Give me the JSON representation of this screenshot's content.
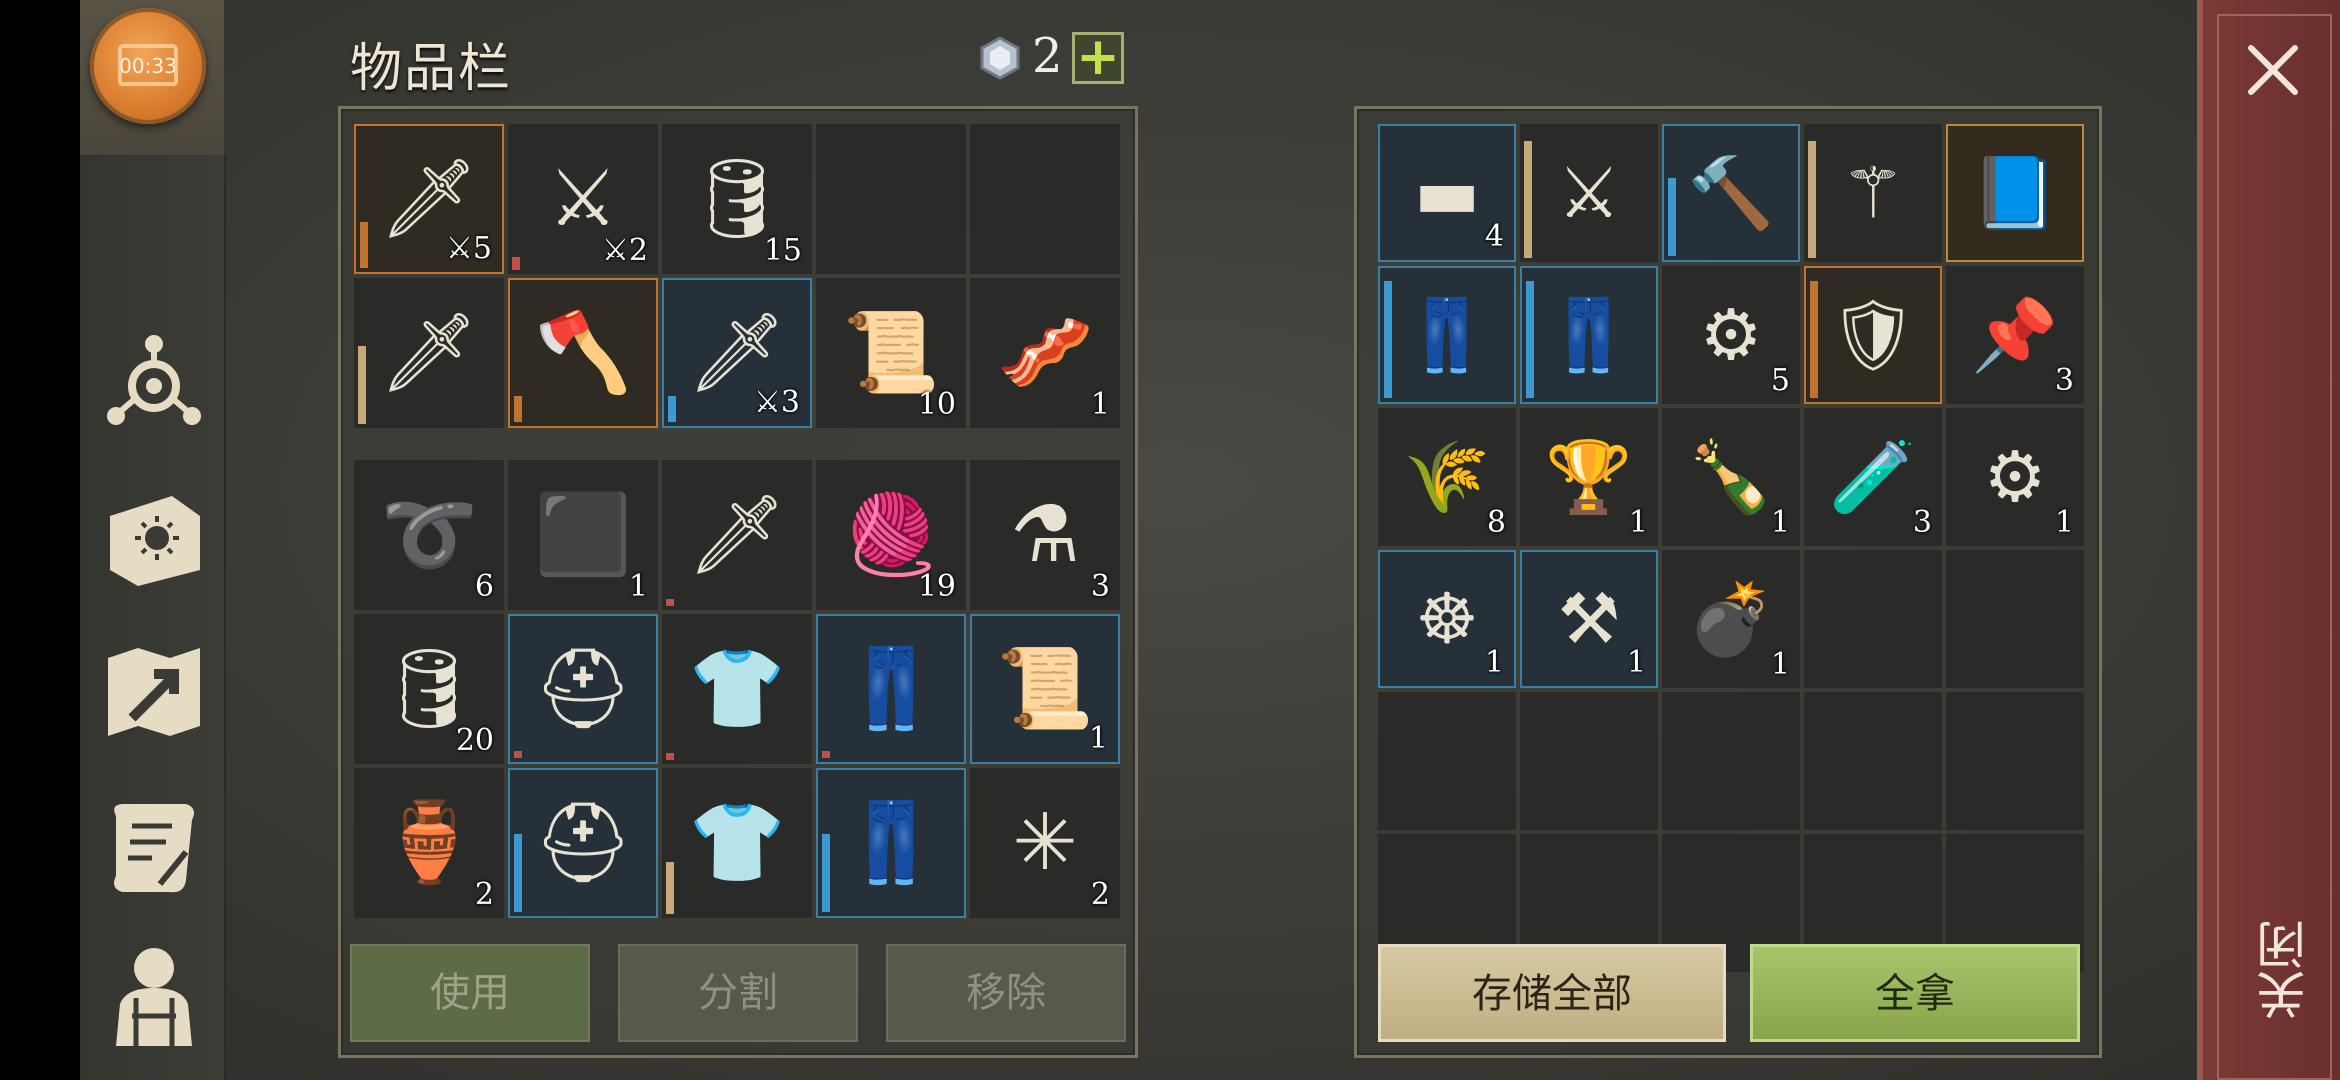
{
  "sidebar": {
    "chest_timer": "00:33",
    "icons": [
      "skills-icon",
      "sun-book-icon",
      "map-icon",
      "quest-scroll-icon",
      "character-icon"
    ]
  },
  "inventory": {
    "title": "物品栏",
    "currency_count": "2",
    "add_label": "+",
    "top_slots": [
      {
        "icon": "scimitar-icon",
        "glyph": "🗡",
        "count": "⚔5",
        "sel": "orange",
        "bar": "#c0742e",
        "barh": 0.35
      },
      {
        "icon": "sword-icon",
        "glyph": "⚔",
        "count": "⚔2",
        "sel": "",
        "bar": "#c0504a",
        "barh": 0.1
      },
      {
        "icon": "barrel-icon",
        "glyph": "🛢",
        "count": "15",
        "sel": "",
        "bar": "",
        "barh": 0
      },
      {
        "icon": "",
        "glyph": "",
        "count": "",
        "sel": "",
        "bar": "",
        "barh": 0
      },
      {
        "icon": "",
        "glyph": "",
        "count": "",
        "sel": "",
        "bar": "",
        "barh": 0
      },
      {
        "icon": "bronze-sword-icon",
        "glyph": "🗡",
        "count": "",
        "sel": "",
        "bar": "#c7a878",
        "barh": 0.6
      },
      {
        "icon": "battle-axe-icon",
        "glyph": "🪓",
        "count": "",
        "sel": "orange",
        "bar": "#c0742e",
        "barh": 0.2
      },
      {
        "icon": "scimitar-icon",
        "glyph": "🗡",
        "count": "⚔3",
        "sel": "blue",
        "bar": "#3c9ad0",
        "barh": 0.2
      },
      {
        "icon": "cloth-roll-icon",
        "glyph": "📜",
        "count": "10",
        "sel": "",
        "bar": "",
        "barh": 0
      },
      {
        "icon": "leather-icon",
        "glyph": "🥓",
        "count": "1",
        "sel": "",
        "bar": "",
        "barh": 0
      }
    ],
    "bottom_slots": [
      {
        "icon": "rope-icon",
        "glyph": "➰",
        "count": "6",
        "sel": "",
        "bar": "",
        "barh": 0
      },
      {
        "icon": "coal-icon",
        "glyph": "⬛",
        "count": "1",
        "sel": "",
        "bar": "",
        "barh": 0
      },
      {
        "icon": "scimitar-icon",
        "glyph": "🗡",
        "count": "",
        "sel": "",
        "bar": "#c0504a",
        "barh": 0.05
      },
      {
        "icon": "fabric-icon",
        "glyph": "🧶",
        "count": "19",
        "sel": "",
        "bar": "",
        "barh": 0
      },
      {
        "icon": "potion-icon",
        "glyph": "⚗",
        "count": "3",
        "sel": "",
        "bar": "",
        "barh": 0
      },
      {
        "icon": "barrel-icon",
        "glyph": "🛢",
        "count": "20",
        "sel": "",
        "bar": "",
        "barh": 0
      },
      {
        "icon": "helmet-icon",
        "glyph": "⛑",
        "count": "",
        "sel": "blue",
        "bar": "#c0504a",
        "barh": 0.05
      },
      {
        "icon": "chainmail-icon",
        "glyph": "👕",
        "count": "",
        "sel": "",
        "bar": "#c0504a",
        "barh": 0.05
      },
      {
        "icon": "greaves-icon",
        "glyph": "👖",
        "count": "",
        "sel": "blue",
        "bar": "#c0504a",
        "barh": 0.05
      },
      {
        "icon": "recipe-scroll-icon",
        "glyph": "📜",
        "count": "1",
        "sel": "blue",
        "bar": "",
        "barh": 0
      },
      {
        "icon": "flask-icon",
        "glyph": "🏺",
        "count": "2",
        "sel": "",
        "bar": "",
        "barh": 0
      },
      {
        "icon": "helmet-icon",
        "glyph": "⛑",
        "count": "",
        "sel": "blue",
        "bar": "#3c9ad0",
        "barh": 0.6
      },
      {
        "icon": "chainmail-icon",
        "glyph": "👕",
        "count": "",
        "sel": "",
        "bar": "#c7a878",
        "barh": 0.4
      },
      {
        "icon": "greaves-icon",
        "glyph": "👖",
        "count": "",
        "sel": "blue",
        "bar": "#3c9ad0",
        "barh": 0.6
      },
      {
        "icon": "scrap-icon",
        "glyph": "✳",
        "count": "2",
        "sel": "",
        "bar": "",
        "barh": 0
      }
    ],
    "buttons": {
      "use": "使用",
      "split": "分割",
      "remove": "移除"
    }
  },
  "container": {
    "slots": [
      {
        "icon": "iron-ingot-icon",
        "glyph": "▬",
        "count": "4",
        "sel": "blue",
        "bar": "",
        "barh": 0
      },
      {
        "icon": "rapier-icon",
        "glyph": "⚔",
        "count": "",
        "sel": "",
        "bar": "#c7a878",
        "barh": 0.9
      },
      {
        "icon": "hammer-icon",
        "glyph": "🔨",
        "count": "",
        "sel": "blue",
        "bar": "#3c9ad0",
        "barh": 0.6
      },
      {
        "icon": "mace-icon",
        "glyph": "⚚",
        "count": "",
        "sel": "",
        "bar": "#c7a878",
        "barh": 0.9
      },
      {
        "icon": "blueprint-book-icon",
        "glyph": "📘",
        "count": "",
        "sel": "gold",
        "bar": "",
        "barh": 0
      },
      {
        "icon": "greaves-icon",
        "glyph": "👖",
        "count": "",
        "sel": "blue",
        "bar": "#3c9ad0",
        "barh": 0.9
      },
      {
        "icon": "greaves-icon",
        "glyph": "👖",
        "count": "",
        "sel": "blue",
        "bar": "#3c9ad0",
        "barh": 0.9
      },
      {
        "icon": "bear-trap-icon",
        "glyph": "⚙",
        "count": "5",
        "sel": "",
        "bar": "",
        "barh": 0
      },
      {
        "icon": "shield-icon",
        "glyph": "🛡",
        "count": "",
        "sel": "orange",
        "bar": "#c0742e",
        "barh": 0.9
      },
      {
        "icon": "nails-icon",
        "glyph": "📌",
        "count": "3",
        "sel": "",
        "bar": "",
        "barh": 0
      },
      {
        "icon": "seeds-icon",
        "glyph": "🌾",
        "count": "8",
        "sel": "",
        "bar": "",
        "barh": 0
      },
      {
        "icon": "goblet-icon",
        "glyph": "🏆",
        "count": "1",
        "sel": "",
        "bar": "",
        "barh": 0
      },
      {
        "icon": "bottle-icon",
        "glyph": "🍾",
        "count": "1",
        "sel": "",
        "bar": "",
        "barh": 0
      },
      {
        "icon": "poison-potion-icon",
        "glyph": "🧪",
        "count": "3",
        "sel": "",
        "bar": "",
        "barh": 0
      },
      {
        "icon": "gear-icon",
        "glyph": "⚙",
        "count": "1",
        "sel": "",
        "bar": "",
        "barh": 0
      },
      {
        "icon": "wheel-icon",
        "glyph": "☸",
        "count": "1",
        "sel": "blue",
        "bar": "",
        "barh": 0
      },
      {
        "icon": "mechanism-icon",
        "glyph": "⚒",
        "count": "1",
        "sel": "blue",
        "bar": "",
        "barh": 0
      },
      {
        "icon": "bomb-icon",
        "glyph": "💣",
        "count": "1",
        "sel": "",
        "bar": "",
        "barh": 0
      },
      {
        "icon": "",
        "glyph": "",
        "count": "",
        "sel": "",
        "bar": "",
        "barh": 0
      },
      {
        "icon": "",
        "glyph": "",
        "count": "",
        "sel": "",
        "bar": "",
        "barh": 0
      },
      {
        "icon": "",
        "glyph": "",
        "count": "",
        "sel": "",
        "bar": "",
        "barh": 0
      },
      {
        "icon": "",
        "glyph": "",
        "count": "",
        "sel": "",
        "bar": "",
        "barh": 0
      },
      {
        "icon": "",
        "glyph": "",
        "count": "",
        "sel": "",
        "bar": "",
        "barh": 0
      },
      {
        "icon": "",
        "glyph": "",
        "count": "",
        "sel": "",
        "bar": "",
        "barh": 0
      },
      {
        "icon": "",
        "glyph": "",
        "count": "",
        "sel": "",
        "bar": "",
        "barh": 0
      },
      {
        "icon": "",
        "glyph": "",
        "count": "",
        "sel": "",
        "bar": "",
        "barh": 0
      },
      {
        "icon": "",
        "glyph": "",
        "count": "",
        "sel": "",
        "bar": "",
        "barh": 0
      },
      {
        "icon": "",
        "glyph": "",
        "count": "",
        "sel": "",
        "bar": "",
        "barh": 0
      },
      {
        "icon": "",
        "glyph": "",
        "count": "",
        "sel": "",
        "bar": "",
        "barh": 0
      },
      {
        "icon": "",
        "glyph": "",
        "count": "",
        "sel": "",
        "bar": "",
        "barh": 0
      }
    ],
    "buttons": {
      "store_all": "存储全部",
      "take_all": "全拿"
    }
  },
  "close": {
    "label": "关闭"
  },
  "colors": {
    "accent_green": "#a9c46a",
    "store_tan": "#d7c9a2",
    "close_red": "#7a3a35"
  }
}
